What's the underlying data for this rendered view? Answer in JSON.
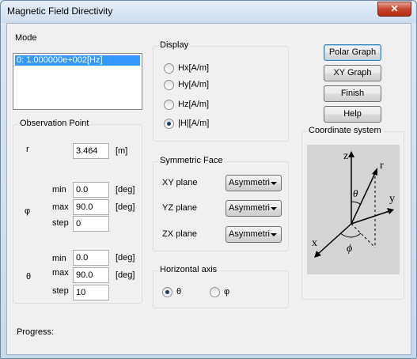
{
  "window": {
    "title": "Magnetic Field Directivity",
    "close_label": "✕"
  },
  "mode": {
    "title": "Mode",
    "items": [
      "0: 1.000000e+002[Hz]"
    ]
  },
  "observation": {
    "title": "Observation Point",
    "r_label": "r",
    "r_value": "3.464",
    "r_unit": "[m]",
    "phi_label": "φ",
    "phi_min": "0.0",
    "phi_max": "90.0",
    "phi_step": "0",
    "theta_label": "θ",
    "theta_min": "0.0",
    "theta_max": "90.0",
    "theta_step": "10",
    "min_label": "min",
    "max_label": "max",
    "step_label": "step",
    "deg_unit": "[deg]"
  },
  "display": {
    "title": "Display",
    "options": [
      "Hx[A/m]",
      "Hy[A/m]",
      "Hz[A/m]",
      "|H|[A/m]"
    ],
    "selected": "|H|[A/m]"
  },
  "symmetric": {
    "title": "Symmetric Face",
    "xy_label": "XY plane",
    "yz_label": "YZ plane",
    "zx_label": "ZX plane",
    "xy_value": "Asymmetric",
    "yz_value": "Asymmetric",
    "zx_value": "Asymmetric"
  },
  "horizontal": {
    "title": "Horizontal axis",
    "theta_label": "θ",
    "phi_label": "φ",
    "selected": "θ"
  },
  "buttons": {
    "polar": "Polar Graph",
    "xy": "XY Graph",
    "finish": "Finish",
    "help": "Help"
  },
  "coordinate": {
    "title": "Coordinate system",
    "z": "z",
    "r": "r",
    "theta": "θ",
    "y": "y",
    "x": "x",
    "phi": "ϕ"
  },
  "progress": {
    "label": "Progress:"
  }
}
